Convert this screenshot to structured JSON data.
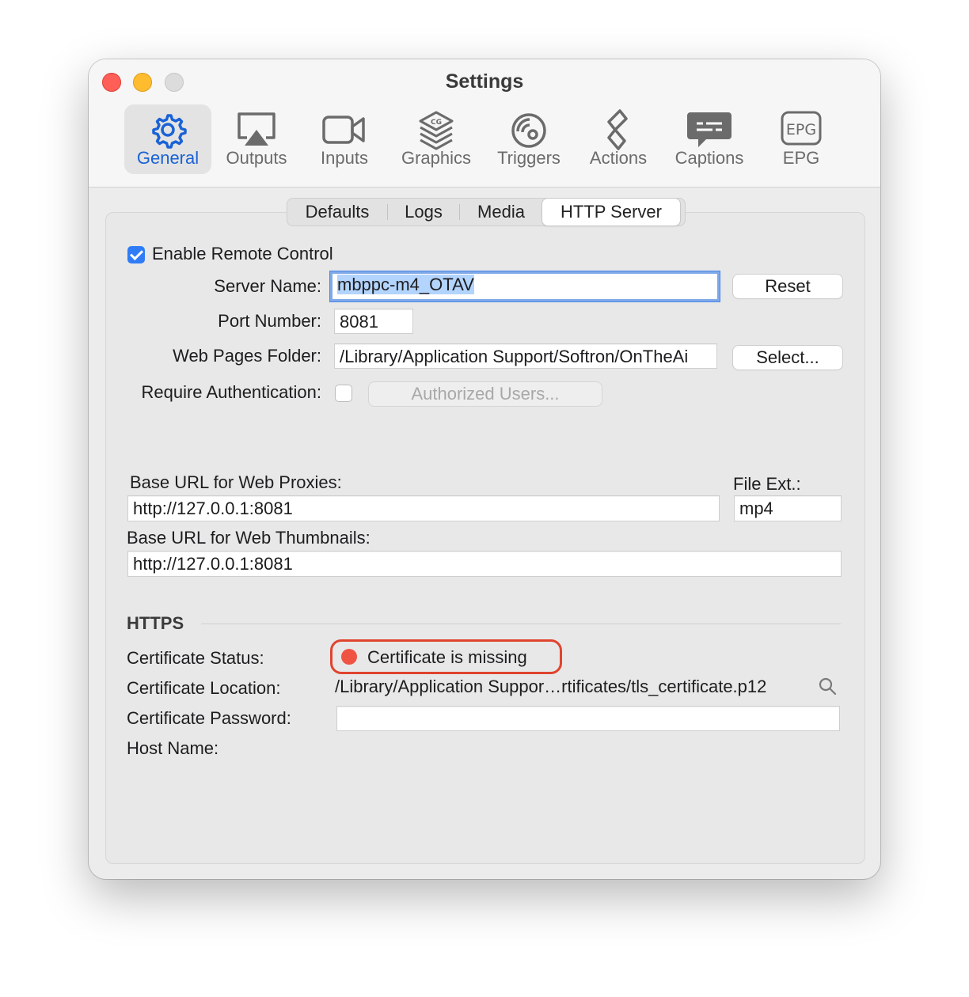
{
  "window": {
    "title": "Settings"
  },
  "toolbar": {
    "items": [
      {
        "label": "General",
        "icon": "gear-icon",
        "active": true
      },
      {
        "label": "Outputs",
        "icon": "airplay-icon"
      },
      {
        "label": "Inputs",
        "icon": "video-camera-icon"
      },
      {
        "label": "Graphics",
        "icon": "cg-layers-icon"
      },
      {
        "label": "Triggers",
        "icon": "trigger-icon"
      },
      {
        "label": "Actions",
        "icon": "actions-icon"
      },
      {
        "label": "Captions",
        "icon": "captions-icon"
      },
      {
        "label": "EPG",
        "icon": "epg-icon"
      }
    ]
  },
  "tabs": {
    "items": [
      "Defaults",
      "Logs",
      "Media",
      "HTTP Server"
    ],
    "selected": "HTTP Server"
  },
  "remote": {
    "enable_label": "Enable Remote Control",
    "enabled": true,
    "server_name_label": "Server Name:",
    "server_name": "mbppc-m4_OTAV",
    "reset_label": "Reset",
    "port_label": "Port Number:",
    "port": "8081",
    "folder_label": "Web Pages Folder:",
    "folder": "/Library/Application Support/Softron/OnTheAi",
    "select_label": "Select...",
    "auth_label": "Require Authentication:",
    "auth_enabled": false,
    "authorized_users_label": "Authorized Users..."
  },
  "urls": {
    "proxies_label": "Base URL for Web Proxies:",
    "proxies": "http://127.0.0.1:8081",
    "file_ext_label": "File Ext.:",
    "file_ext": "mp4",
    "thumbnails_label": "Base URL for Web Thumbnails:",
    "thumbnails": "http://127.0.0.1:8081"
  },
  "https": {
    "heading": "HTTPS",
    "status_label": "Certificate Status:",
    "status": "Certificate is missing",
    "status_color": "#ef5443",
    "location_label": "Certificate Location:",
    "location": "/Library/Application Suppor…rtificates/tls_certificate.p12",
    "password_label": "Certificate Password:",
    "password": "",
    "host_label": "Host Name:",
    "host": ""
  }
}
